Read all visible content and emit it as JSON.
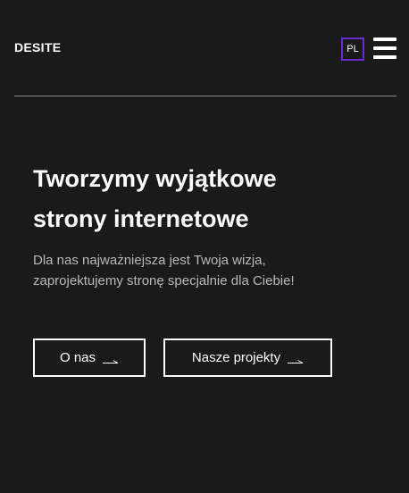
{
  "header": {
    "logo": "DESITE",
    "lang": "PL",
    "menu_icon": "hamburger-menu-icon"
  },
  "hero": {
    "title_line1": "Tworzymy wyjątkowe",
    "title_line2": "strony internetowe",
    "subtitle": "Dla nas najważniejsza jest Twoja wizja, zaprojektujemy stronę specjalnie dla Ciebie!",
    "buttons": [
      {
        "label": "O nas",
        "icon": "arrow-right-icon"
      },
      {
        "label": "Nasze projekty",
        "icon": "arrow-right-icon"
      }
    ]
  },
  "colors": {
    "background": "#1a1a1a",
    "accent": "#6a2bd4",
    "text": "#ffffff",
    "muted_text": "#b9b9b9",
    "divider": "#8a8a8a"
  }
}
